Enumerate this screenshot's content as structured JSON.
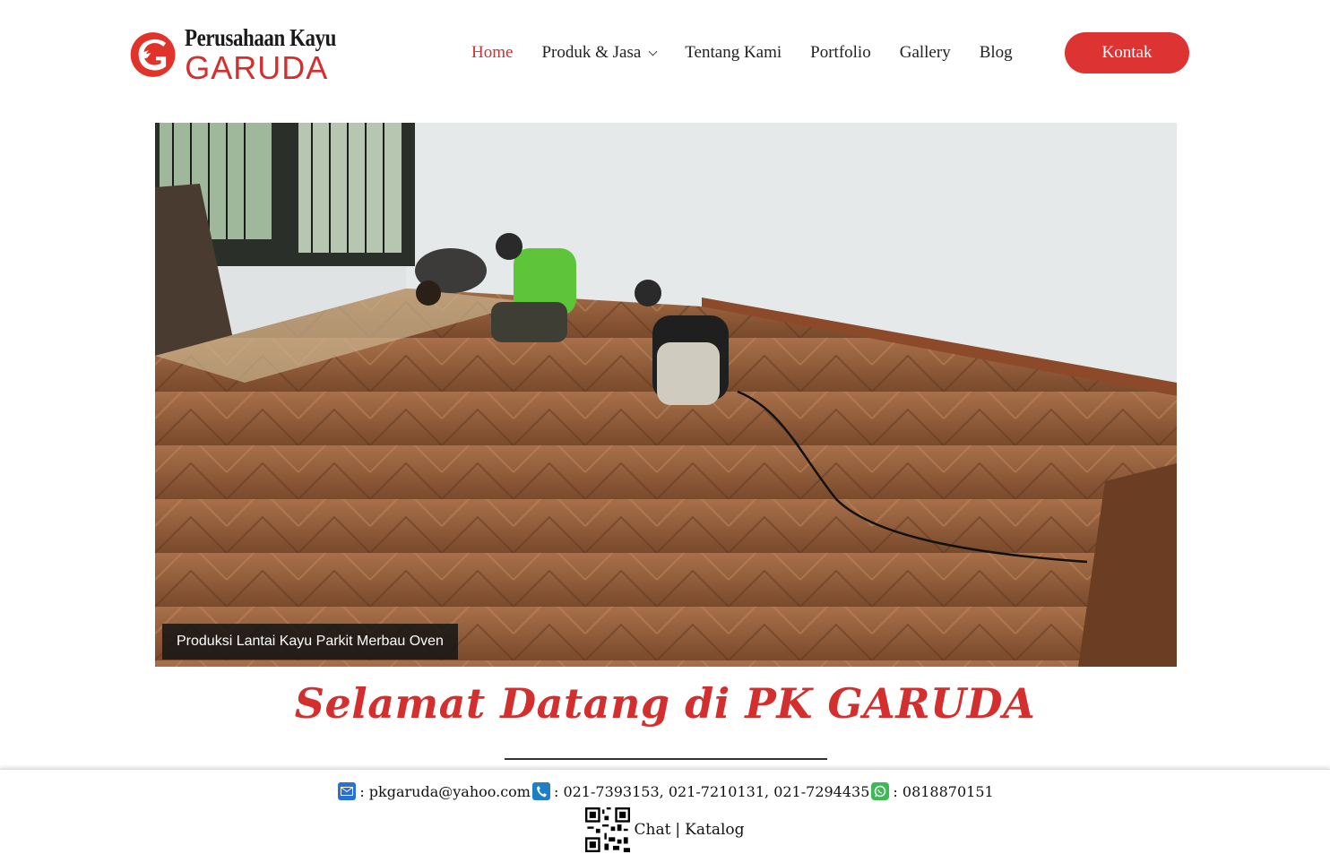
{
  "brand": {
    "line1": "Perusahaan Kayu",
    "line2": "GARUDA",
    "color": "#d62e2e"
  },
  "nav": {
    "items": [
      {
        "label": "Home",
        "active": true
      },
      {
        "label": "Produk & Jasa",
        "dropdown": true
      },
      {
        "label": "Tentang Kami"
      },
      {
        "label": "Portfolio"
      },
      {
        "label": "Gallery"
      },
      {
        "label": "Blog"
      }
    ],
    "cta": "Kontak",
    "accent": "#dd3333"
  },
  "hero": {
    "caption": "Produksi Lantai Kayu Parkit Merbau Oven"
  },
  "welcome": "Selamat Datang di PK GARUDA",
  "footer": {
    "email": ": pkgaruda@yahoo.com",
    "phones": ": 021-7393153, 021-7210131, 021-7294435",
    "whatsapp": ": 0818870151",
    "chat": "Chat",
    "separator": "|",
    "catalog": "Katalog"
  }
}
